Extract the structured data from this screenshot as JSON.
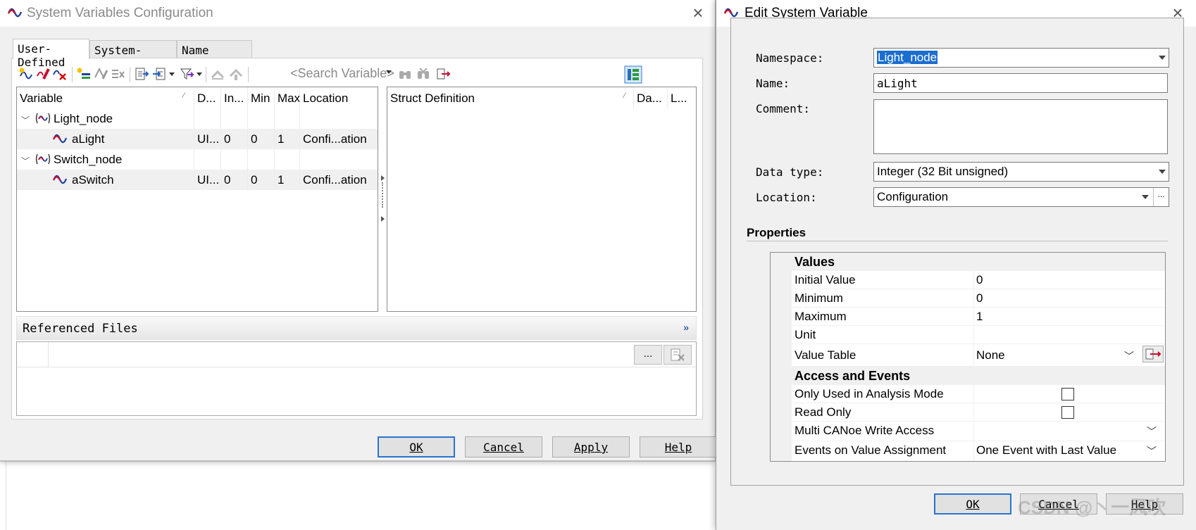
{
  "left_dialog": {
    "title": "System Variables Configuration",
    "tabs": [
      "User-Defined",
      "System-Defined",
      "Name Display"
    ],
    "search_placeholder": "<Search Variable>",
    "variable_grid": {
      "columns": [
        "Variable",
        "D...",
        "In...",
        "Min",
        "Max",
        "Location"
      ],
      "rows": [
        {
          "type": "namespace",
          "name": "Light_node",
          "cells": [
            "",
            "",
            "",
            "",
            ""
          ]
        },
        {
          "type": "variable",
          "name": "aLight",
          "cells": [
            "UI...",
            "0",
            "0",
            "1",
            "Confi...ation"
          ]
        },
        {
          "type": "namespace",
          "name": "Switch_node",
          "cells": [
            "",
            "",
            "",
            "",
            ""
          ]
        },
        {
          "type": "variable",
          "name": "aSwitch",
          "cells": [
            "UI...",
            "0",
            "0",
            "1",
            "Confi...ation"
          ]
        }
      ]
    },
    "struct_grid": {
      "columns": [
        "Struct Definition",
        "Da...",
        "L..."
      ]
    },
    "referenced_files": {
      "title": "Referenced Files",
      "browse_label": "...",
      "collapse_glyph": "»"
    },
    "buttons": {
      "ok": "OK",
      "cancel": "Cancel",
      "apply": "Apply",
      "help": "Help"
    }
  },
  "right_dialog": {
    "title": "Edit System Variable",
    "fields": {
      "namespace_label": "Namespace:",
      "namespace_value": "Light_node",
      "name_label": "Name:",
      "name_value": "aLight",
      "comment_label": "Comment:",
      "comment_value": "",
      "datatype_label": "Data type:",
      "datatype_value": "Integer (32 Bit unsigned)",
      "location_label": "Location:",
      "location_value": "Configuration",
      "location_more": "..."
    },
    "properties": {
      "title": "Properties",
      "values_category": "Values",
      "initial_value_label": "Initial Value",
      "initial_value": "0",
      "minimum_label": "Minimum",
      "minimum": "0",
      "maximum_label": "Maximum",
      "maximum": "1",
      "unit_label": "Unit",
      "unit": "",
      "value_table_label": "Value Table",
      "value_table": "None",
      "access_category": "Access and Events",
      "analysis_mode_label": "Only Used in Analysis Mode",
      "analysis_mode_checked": false,
      "read_only_label": "Read Only",
      "read_only_checked": false,
      "multi_write_label": "Multi CANoe Write Access",
      "multi_write_value": "",
      "events_label": "Events on Value Assignment",
      "events_value": "One Event with Last Value"
    },
    "buttons": {
      "ok": "OK",
      "cancel": "Cancel",
      "help": "Help"
    }
  },
  "watermark": "CSDN @丶一风吹",
  "colors": {
    "accent": "#1c6dd0",
    "default_button_border": "#2a73d3",
    "signal_red": "#c8102e",
    "signal_blue": "#1f3f9e"
  }
}
